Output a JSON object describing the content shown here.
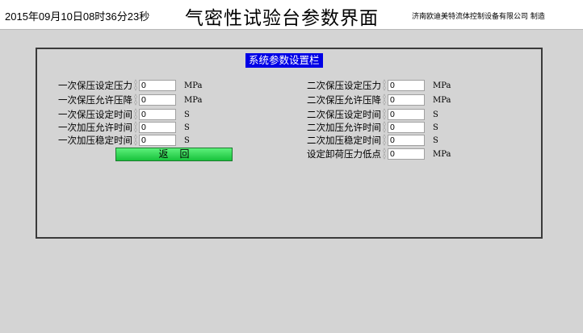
{
  "header": {
    "datetime": "2015年09月10日08时36分23秒",
    "title": "气密性试验台参数界面",
    "maker": "济南欧迪美特流体控制设备有限公司  制造"
  },
  "panel": {
    "title": "系统参数设置栏",
    "left_rows": [
      {
        "label": "一次保压设定压力",
        "value": "0",
        "unit": "MPa"
      },
      {
        "label": "一次保压允许压降",
        "value": "0",
        "unit": "MPa"
      },
      {
        "label": "一次保压设定时间",
        "value": "0",
        "unit": "S"
      },
      {
        "label": "一次加压允许时间",
        "value": "0",
        "unit": "S"
      },
      {
        "label": "一次加压稳定时间",
        "value": "0",
        "unit": "S"
      }
    ],
    "right_rows": [
      {
        "label": "二次保压设定压力",
        "value": "0",
        "unit": "MPa"
      },
      {
        "label": "二次保压允许压降",
        "value": "0",
        "unit": "MPa"
      },
      {
        "label": "二次保压设定时间",
        "value": "0",
        "unit": "S"
      },
      {
        "label": "二次加压允许时间",
        "value": "0",
        "unit": "S"
      },
      {
        "label": "二次加压稳定时间",
        "value": "0",
        "unit": "S"
      },
      {
        "label": "设定卸荷压力低点",
        "value": "0",
        "unit": "MPa"
      }
    ],
    "back_button": "返回"
  },
  "icons": {
    "spin": "spin-arrows-icon"
  },
  "colors": {
    "title_bg": "#0000e6",
    "button": "#18c23c",
    "background": "#d4d4d4"
  }
}
